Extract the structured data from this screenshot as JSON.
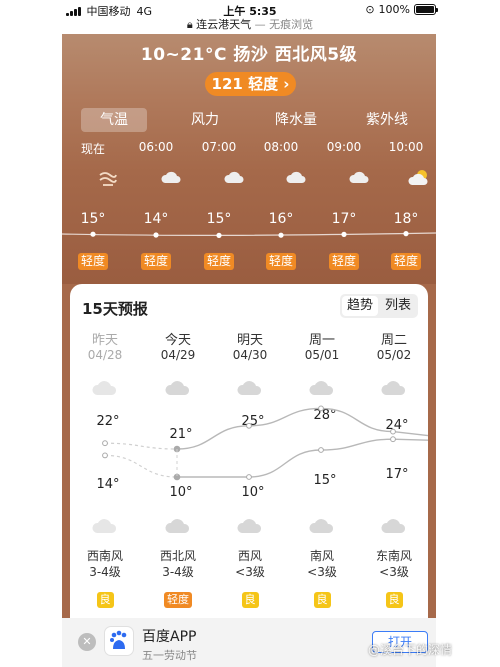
{
  "status_bar": {
    "carrier": "中国移动",
    "network": "4G",
    "time": "上午 5:35",
    "battery": "100%",
    "battery_level": 1.0
  },
  "url_bar": {
    "site": "连云港天气",
    "mode": "— 无痕浏览",
    "lock_icon": "lock-icon"
  },
  "header": {
    "headline": "10~21°C 扬沙 西北风5级",
    "aqi": "121 轻度 ›"
  },
  "tabs": [
    "气温",
    "风力",
    "降水量",
    "紫外线"
  ],
  "active_tab": 0,
  "hourly": [
    {
      "time": "现在",
      "icon": "sand-wind-icon",
      "temp": "15°",
      "aqi": "轻度"
    },
    {
      "time": "06:00",
      "icon": "cloud-icon",
      "temp": "14°",
      "aqi": "轻度"
    },
    {
      "time": "07:00",
      "icon": "cloud-icon",
      "temp": "15°",
      "aqi": "轻度"
    },
    {
      "time": "08:00",
      "icon": "cloud-icon",
      "temp": "16°",
      "aqi": "轻度"
    },
    {
      "time": "09:00",
      "icon": "cloud-icon",
      "temp": "17°",
      "aqi": "轻度"
    },
    {
      "time": "10:00",
      "icon": "sun-cloud-icon",
      "temp": "18°",
      "aqi": "轻度"
    }
  ],
  "forecast": {
    "title": "15天预报",
    "view_options": [
      "趋势",
      "列表"
    ],
    "days": [
      {
        "name": "昨天",
        "date": "04/28",
        "high": "22°",
        "low": "14°",
        "wind_dir": "西南风",
        "wind_level": "3-4级",
        "aqi": "良",
        "aqi_color": "#f5c518",
        "past": true
      },
      {
        "name": "今天",
        "date": "04/29",
        "high": "21°",
        "low": "10°",
        "wind_dir": "西北风",
        "wind_level": "3-4级",
        "aqi": "轻度",
        "aqi_color": "#f08a24",
        "past": false
      },
      {
        "name": "明天",
        "date": "04/30",
        "high": "25°",
        "low": "10°",
        "wind_dir": "西风",
        "wind_level": "<3级",
        "aqi": "良",
        "aqi_color": "#f5c518",
        "past": false
      },
      {
        "name": "周一",
        "date": "05/01",
        "high": "28°",
        "low": "15°",
        "wind_dir": "南风",
        "wind_level": "<3级",
        "aqi": "良",
        "aqi_color": "#f5c518",
        "past": false
      },
      {
        "name": "周二",
        "date": "05/02",
        "high": "24°",
        "low": "17°",
        "wind_dir": "东南风",
        "wind_level": "<3级",
        "aqi": "良",
        "aqi_color": "#f5c518",
        "past": false
      }
    ]
  },
  "banner": {
    "app_name": "百度APP",
    "subtitle": "五一劳动节",
    "open_label": "打开"
  },
  "watermark": "@溪台下的深情",
  "colors": {
    "hero": "#a6694a",
    "accent_orange": "#f08a24",
    "good_yellow": "#f5c518"
  }
}
